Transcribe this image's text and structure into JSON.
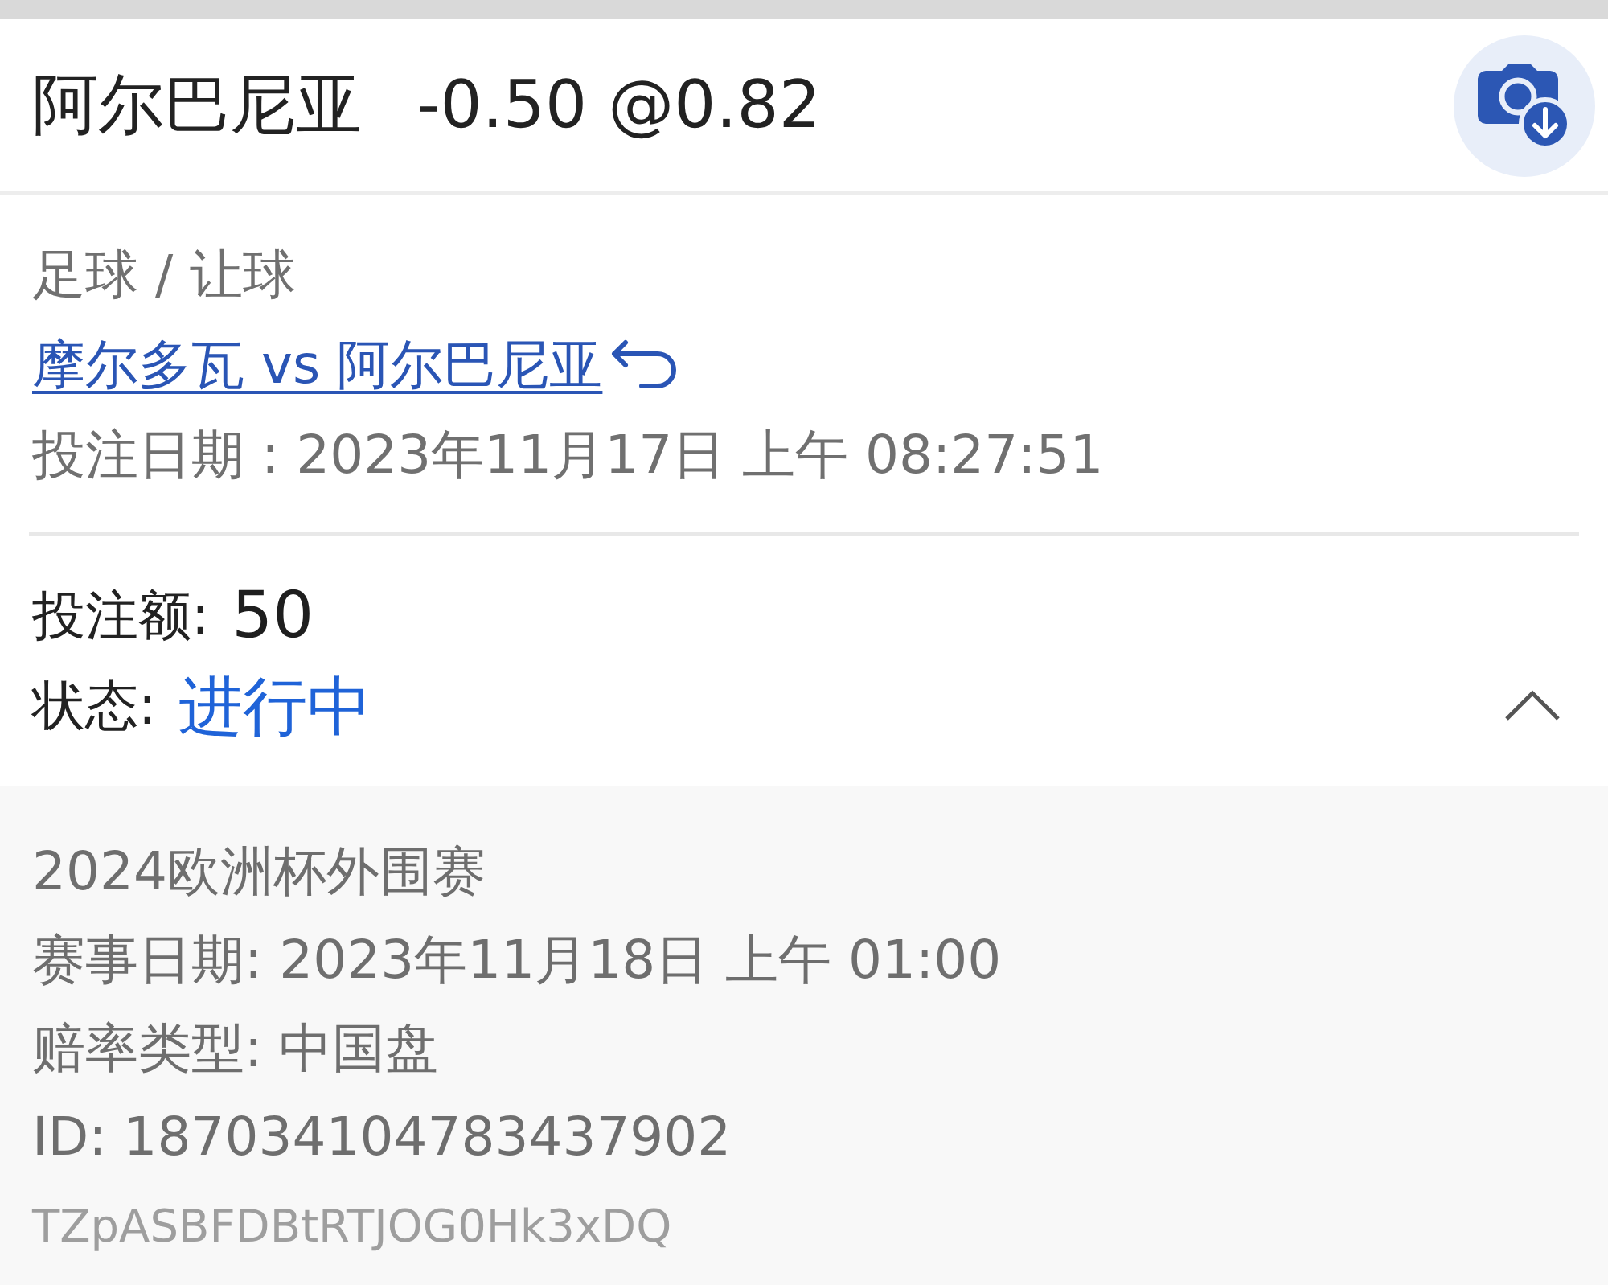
{
  "header": {
    "selection": "阿尔巴尼亚",
    "handicap_odds": "-0.50 @0.82"
  },
  "bet_info": {
    "category": "足球 / 让球",
    "match_link": "摩尔多瓦 vs 阿尔巴尼亚",
    "bet_date": "投注日期 : 2023年11月17日 上午 08:27:51"
  },
  "stake": {
    "label": "投注额:",
    "value": "50"
  },
  "status": {
    "label": "状态:",
    "value": "进行中"
  },
  "details_expanded": true,
  "details": {
    "competition": "2024欧洲杯外围赛",
    "event_date": "赛事日期: 2023年11月18日 上午 01:00",
    "odds_type": "赔率类型: 中国盘",
    "id": "ID: 187034104783437902",
    "reference": "TZpASBFDBtRTJOG0Hk3xDQ"
  }
}
